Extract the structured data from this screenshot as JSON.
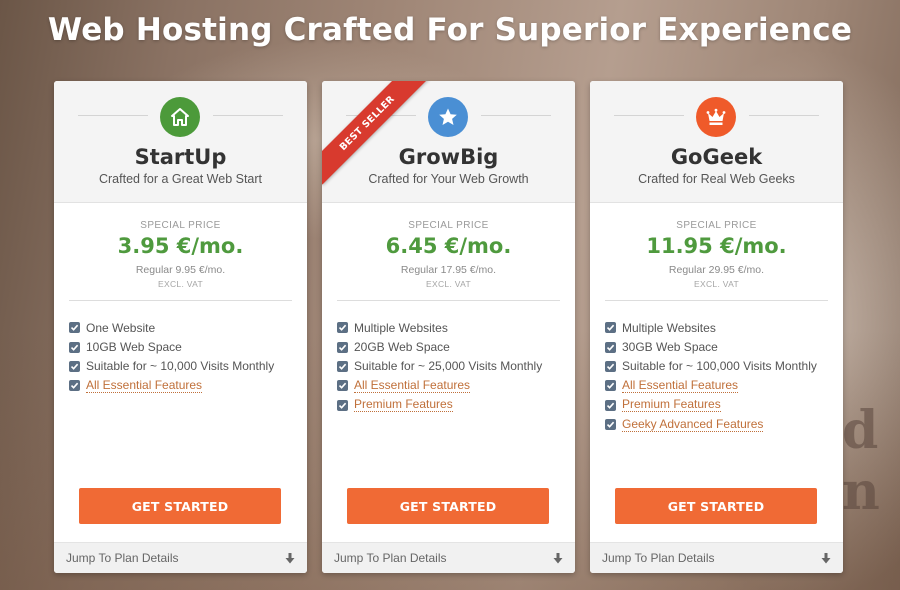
{
  "page": {
    "heading": "Web Hosting Crafted For Superior Experience",
    "background_letters": "d n"
  },
  "colors": {
    "price_green": "#4f9a3e",
    "button_orange": "#f06a35",
    "link_orange": "#c0703a",
    "ribbon_red": "#d83a2e",
    "startup_icon": "#4c9a3a",
    "growbig_icon": "#4a8fd4",
    "gogeek_icon": "#ef5a2a",
    "checkbox": "#5c6f84"
  },
  "plans": [
    {
      "icon": "house-icon",
      "name": "StartUp",
      "tagline": "Crafted for a Great Web Start",
      "special_label": "SPECIAL PRICE",
      "price": "3.95 €/mo.",
      "regular": "Regular 9.95 €/mo.",
      "vat": "EXCL. VAT",
      "features": [
        {
          "text": "One Website",
          "link": false
        },
        {
          "text": "10GB Web Space",
          "link": false
        },
        {
          "text": "Suitable for ~ 10,000 Visits Monthly",
          "link": false
        },
        {
          "text": "All Essential Features",
          "link": true
        }
      ],
      "button": "GET STARTED",
      "footer": "Jump To Plan Details"
    },
    {
      "icon": "star-icon",
      "name": "GrowBig",
      "tagline": "Crafted for Your Web Growth",
      "ribbon": "BEST SELLER",
      "special_label": "SPECIAL PRICE",
      "price": "6.45 €/mo.",
      "regular": "Regular 17.95 €/mo.",
      "vat": "EXCL. VAT",
      "features": [
        {
          "text": "Multiple Websites",
          "link": false
        },
        {
          "text": "20GB Web Space",
          "link": false
        },
        {
          "text": "Suitable for ~ 25,000 Visits Monthly",
          "link": false
        },
        {
          "text": "All Essential Features",
          "link": true
        },
        {
          "text": "Premium Features",
          "link": true
        }
      ],
      "button": "GET STARTED",
      "footer": "Jump To Plan Details"
    },
    {
      "icon": "crown-icon",
      "name": "GoGeek",
      "tagline": "Crafted for Real Web Geeks",
      "special_label": "SPECIAL PRICE",
      "price": "11.95 €/mo.",
      "regular": "Regular 29.95 €/mo.",
      "vat": "EXCL. VAT",
      "features": [
        {
          "text": "Multiple Websites",
          "link": false
        },
        {
          "text": "30GB Web Space",
          "link": false
        },
        {
          "text": "Suitable for ~ 100,000 Visits Monthly",
          "link": false
        },
        {
          "text": "All Essential Features",
          "link": true
        },
        {
          "text": "Premium Features",
          "link": true
        },
        {
          "text": "Geeky Advanced Features",
          "link": true
        }
      ],
      "button": "GET STARTED",
      "footer": "Jump To Plan Details"
    }
  ]
}
